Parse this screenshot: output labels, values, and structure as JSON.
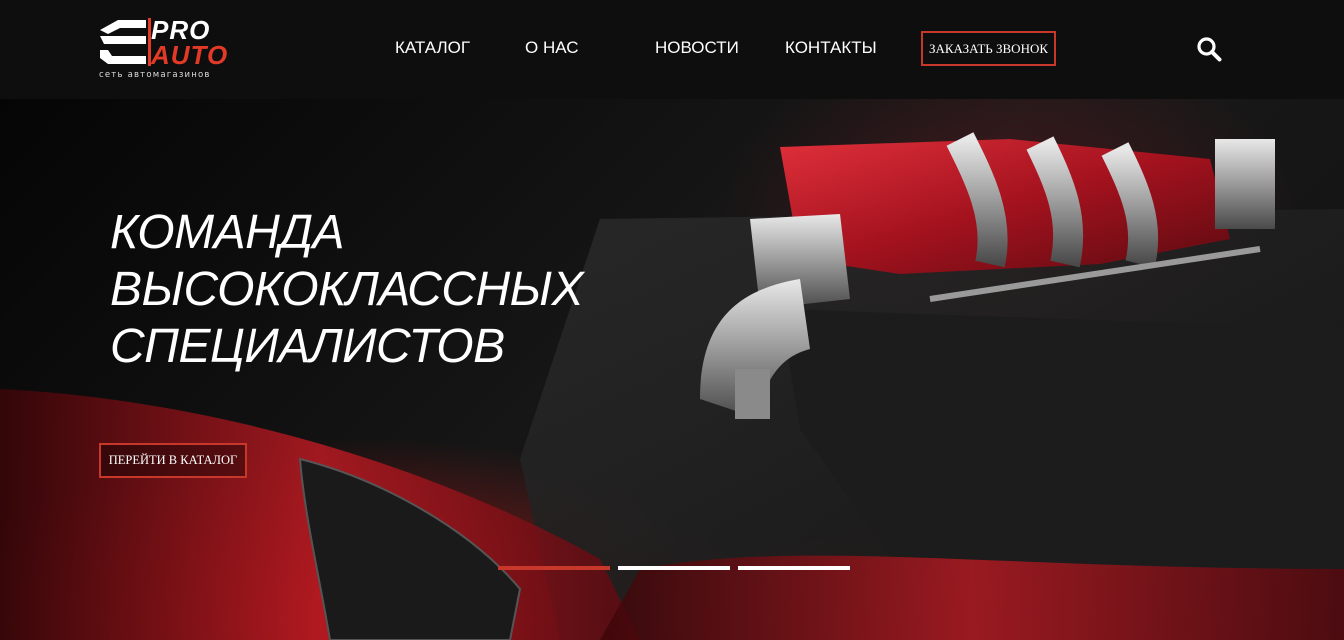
{
  "logo": {
    "pro": "PRO",
    "auto": "AUTO",
    "tagline": "сеть автомагазинов"
  },
  "nav": {
    "items": [
      "КАТАЛОГ",
      "О НАС",
      "НОВОСТИ",
      "КОНТАКТЫ"
    ]
  },
  "header": {
    "call_button": "ЗАКАЗАТЬ ЗВОНОК",
    "search_icon": "search-icon"
  },
  "hero": {
    "headline_lines": [
      "КОМАНДА",
      "ВЫСОКОКЛАССНЫХ",
      "СПЕЦИАЛИСТОВ"
    ],
    "cta_label": "ПЕРЕЙТИ В КАТАЛОГ",
    "slider": {
      "count": 3,
      "active_index": 0
    }
  },
  "colors": {
    "accent": "#c7372a",
    "header_bg": "#0e0e0e",
    "text": "#ffffff"
  }
}
